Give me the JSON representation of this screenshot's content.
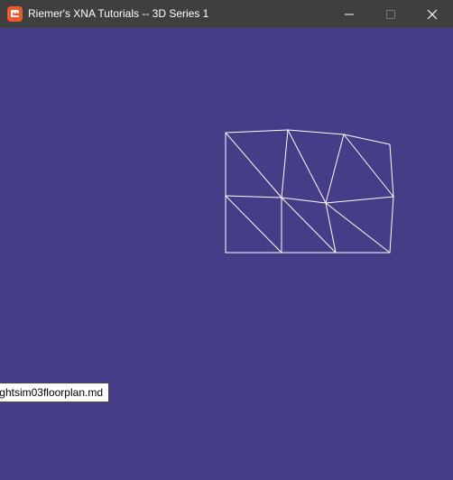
{
  "window": {
    "title": "Riemer's XNA Tutorials -- 3D Series 1",
    "app_icon": "monogame-logo-icon",
    "controls": {
      "minimize_icon": "minimize-icon",
      "maximize_icon": "maximize-icon",
      "close_icon": "close-icon"
    }
  },
  "scene": {
    "background_color": "#463d88",
    "wireframe_color": "#ffffff",
    "mesh": "triangle-wireframe-grid"
  },
  "tooltip": {
    "text": "ghtsim03floorplan.md"
  },
  "colors": {
    "titlebar": "#3f3f3f",
    "client_background": "#463d88",
    "icon_orange": "#f0582b"
  }
}
